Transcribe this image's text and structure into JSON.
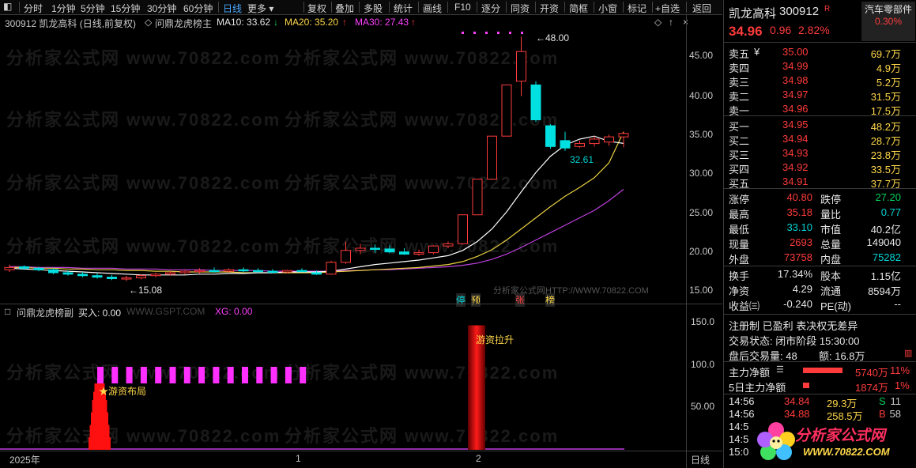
{
  "toolbar": {
    "left_items": [
      "分时",
      "1分钟",
      "5分钟",
      "15分钟",
      "30分钟",
      "60分钟",
      "日线",
      "更多"
    ],
    "right_items": [
      "复权",
      "叠加",
      "多股",
      "统计",
      "画线",
      "F10",
      "逐分",
      "同资",
      "开资",
      "简框",
      "小窗",
      "标记",
      "+自选",
      "返回"
    ],
    "active": "日线"
  },
  "infobar": {
    "code_name": "300912 凯龙高科 (日线,前复权)",
    "indicator": "问鼎龙虎榜主",
    "ma10": "MA10: 33.62",
    "ma10_arrow": "↓",
    "ma20": "MA20: 35.20",
    "ma20_arrow": "↑",
    "ma30": "MA30: 27.43",
    "ma30_arrow": "↑"
  },
  "main_chart": {
    "y_ticks": [
      "45.00",
      "40.00",
      "35.00",
      "30.00",
      "25.00",
      "20.00",
      "15.00"
    ],
    "high_label": "48.00",
    "low_label": "15.08",
    "mid_label": "32.61",
    "markers": [
      "停",
      "预",
      "张",
      "榜"
    ],
    "watermark_small": "分析家公式网HTTP://WWW.70822.COM",
    "watermark": "分析家公式网 www.70822.com"
  },
  "sub_chart": {
    "indicator": "问鼎龙虎榜副",
    "buy": "买入: 0.00",
    "site": "WWW.GSPT.COM",
    "xg": "XG: 0.00",
    "y_ticks": [
      "150.0",
      "100.0",
      "50.00"
    ],
    "label_layout": "★游资布局",
    "label_pull": "游资拉升"
  },
  "x_axis": {
    "year": "2025年",
    "m1": "1",
    "m2": "2",
    "period": "日线"
  },
  "quote": {
    "name": "凯龙高科",
    "code": "300912",
    "r_badge": "R",
    "sector": "汽车零部件",
    "price": "34.96",
    "change": "0.96",
    "pct": "2.82%",
    "sector_pct": "0.30%",
    "asks": [
      {
        "label": "卖五",
        "price": "35.00",
        "vol": "69.7万",
        "flag": "¥"
      },
      {
        "label": "卖四",
        "price": "34.99",
        "vol": "4.9万",
        "flag": ""
      },
      {
        "label": "卖三",
        "price": "34.98",
        "vol": "5.2万",
        "flag": ""
      },
      {
        "label": "卖二",
        "price": "34.97",
        "vol": "31.5万",
        "flag": ""
      },
      {
        "label": "卖一",
        "price": "34.96",
        "vol": "17.5万",
        "flag": ""
      }
    ],
    "bids": [
      {
        "label": "买一",
        "price": "34.95",
        "vol": "48.2万"
      },
      {
        "label": "买二",
        "price": "34.94",
        "vol": "28.7万"
      },
      {
        "label": "买三",
        "price": "34.93",
        "vol": "23.8万"
      },
      {
        "label": "买四",
        "price": "34.92",
        "vol": "33.5万"
      },
      {
        "label": "买五",
        "price": "34.91",
        "vol": "37.7万"
      }
    ],
    "stats": [
      {
        "l1": "涨停",
        "v1": "40.80",
        "c1": "red",
        "l2": "跌停",
        "v2": "27.20",
        "c2": "green"
      },
      {
        "l1": "最高",
        "v1": "35.18",
        "c1": "red",
        "l2": "量比",
        "v2": "0.77",
        "c2": "cyan"
      },
      {
        "l1": "最低",
        "v1": "33.10",
        "c1": "cyan",
        "l2": "市值",
        "v2": "40.2亿",
        "c2": "white"
      },
      {
        "l1": "现量",
        "v1": "2693",
        "c1": "red",
        "l2": "总量",
        "v2": "149040",
        "c2": "white"
      },
      {
        "l1": "外盘",
        "v1": "73758",
        "c1": "red",
        "l2": "内盘",
        "v2": "75282",
        "c2": "cyan"
      }
    ],
    "stats2": [
      {
        "l1": "换手",
        "v1": "17.34%",
        "l2": "股本",
        "v2": "1.15亿"
      },
      {
        "l1": "净资",
        "v1": "4.29",
        "l2": "流通",
        "v2": "8594万"
      },
      {
        "l1": "收益㈢",
        "v1": "-0.240",
        "l2": "PE(动)",
        "v2": "--"
      }
    ],
    "notes": {
      "line1": "注册制 已盈利 表决权无差异",
      "line2": "交易状态: 闭市阶段 15:30:00",
      "line3a": "盘后交易量: 48",
      "line3b": "额: 16.8万"
    },
    "flows": [
      {
        "label": "主力净额",
        "val": "5740万",
        "pct": "11%"
      },
      {
        "label": "5日主力净额",
        "val": "1874万",
        "pct": "1%"
      }
    ],
    "ticks": [
      {
        "t": "14:56",
        "p": "34.84",
        "v": "29.3万",
        "s": "S",
        "n": "11",
        "sc": "green"
      },
      {
        "t": "14:56",
        "p": "34.88",
        "v": "258.5万",
        "s": "B",
        "n": "58",
        "sc": "red"
      },
      {
        "t": "14:5",
        "p": "",
        "v": "",
        "s": "",
        "n": "",
        "sc": "gray"
      },
      {
        "t": "14:5",
        "p": "",
        "v": "",
        "s": "",
        "n": "",
        "sc": "gray"
      },
      {
        "t": "15:0",
        "p": "",
        "v": "",
        "s": "",
        "n": "",
        "sc": "gray"
      }
    ],
    "logo_text": "分析家公式网",
    "logo_url": "WWW.70822.COM"
  },
  "chart_data": {
    "type": "candlestick",
    "ylim": [
      13,
      49
    ],
    "candles": [
      [
        16.6,
        17.3,
        16.3,
        16.9
      ],
      [
        17.0,
        17.2,
        16.6,
        16.8
      ],
      [
        16.8,
        17.0,
        16.4,
        16.6
      ],
      [
        16.6,
        16.8,
        16.0,
        16.2
      ],
      [
        16.2,
        16.5,
        15.8,
        16.0
      ],
      [
        16.0,
        16.3,
        15.6,
        15.8
      ],
      [
        15.8,
        16.1,
        15.4,
        15.6
      ],
      [
        15.6,
        15.9,
        15.2,
        15.4
      ],
      [
        15.4,
        15.8,
        15.08,
        15.5
      ],
      [
        15.5,
        16.0,
        15.3,
        15.8
      ],
      [
        15.8,
        16.2,
        15.6,
        16.0
      ],
      [
        16.0,
        16.4,
        15.8,
        16.2
      ],
      [
        16.2,
        16.6,
        16.0,
        16.4
      ],
      [
        16.4,
        16.8,
        16.1,
        16.5
      ],
      [
        16.5,
        16.9,
        16.2,
        16.4
      ],
      [
        16.4,
        16.8,
        16.2,
        16.6
      ],
      [
        16.6,
        16.9,
        16.3,
        16.5
      ],
      [
        16.5,
        16.8,
        16.2,
        16.4
      ],
      [
        16.4,
        16.7,
        16.1,
        16.3
      ],
      [
        16.3,
        16.6,
        16.1,
        16.5
      ],
      [
        16.5,
        16.8,
        16.3,
        16.4
      ],
      [
        16.2,
        16.5,
        15.9,
        16.0
      ],
      [
        16.0,
        17.8,
        15.9,
        17.6
      ],
      [
        17.6,
        20.4,
        17.4,
        19.2
      ],
      [
        19.2,
        20.1,
        18.7,
        19.5
      ],
      [
        19.5,
        20.0,
        18.9,
        19.4
      ],
      [
        19.4,
        19.9,
        18.8,
        19.0
      ],
      [
        19.0,
        19.5,
        18.6,
        18.7
      ],
      [
        18.7,
        19.3,
        18.5,
        18.9
      ],
      [
        18.9,
        19.9,
        18.7,
        19.8
      ],
      [
        19.8,
        20.4,
        19.5,
        20.1
      ],
      [
        20.1,
        24.0,
        20.0,
        24.0
      ],
      [
        24.0,
        28.8,
        24.0,
        28.8
      ],
      [
        28.8,
        34.6,
        28.8,
        34.6
      ],
      [
        34.6,
        41.5,
        34.6,
        41.5
      ],
      [
        42.0,
        48.0,
        40.0,
        46.0
      ],
      [
        41.5,
        42.0,
        36.5,
        36.8
      ],
      [
        36.0,
        36.2,
        32.9,
        33.2
      ],
      [
        34.0,
        35.2,
        32.61,
        33.0
      ],
      [
        33.2,
        34.0,
        33.0,
        33.6
      ],
      [
        33.6,
        34.6,
        33.2,
        34.2
      ],
      [
        33.8,
        34.8,
        33.3,
        34.5
      ],
      [
        34.5,
        35.18,
        33.1,
        34.96
      ]
    ],
    "ma10": [
      16.8,
      16.7,
      16.6,
      16.5,
      16.4,
      16.3,
      16.2,
      16.1,
      16.0,
      15.9,
      15.9,
      15.9,
      15.9,
      16.0,
      16.0,
      16.1,
      16.1,
      16.2,
      16.2,
      16.3,
      16.3,
      16.3,
      16.4,
      16.7,
      17.0,
      17.3,
      17.5,
      17.7,
      17.9,
      18.2,
      18.5,
      19.2,
      20.4,
      22.1,
      24.4,
      27.1,
      29.7,
      31.9,
      33.4,
      34.2,
      34.6,
      33.9,
      33.62
    ],
    "ma20": [
      16.9,
      16.9,
      16.8,
      16.8,
      16.7,
      16.7,
      16.6,
      16.6,
      16.5,
      16.5,
      16.4,
      16.4,
      16.3,
      16.3,
      16.3,
      16.3,
      16.2,
      16.2,
      16.2,
      16.2,
      16.2,
      16.2,
      16.3,
      16.4,
      16.5,
      16.6,
      16.7,
      16.8,
      16.9,
      17.1,
      17.3,
      17.7,
      18.4,
      19.3,
      20.6,
      22.1,
      23.6,
      25.1,
      26.5,
      27.7,
      29.0,
      31.0,
      35.2
    ],
    "ma30": [
      17.0,
      17.0,
      16.9,
      16.9,
      16.9,
      16.8,
      16.8,
      16.8,
      16.7,
      16.7,
      16.7,
      16.6,
      16.6,
      16.6,
      16.5,
      16.5,
      16.5,
      16.5,
      16.4,
      16.4,
      16.4,
      16.4,
      16.4,
      16.5,
      16.5,
      16.6,
      16.6,
      16.7,
      16.8,
      16.9,
      17.0,
      17.2,
      17.5,
      18.0,
      18.7,
      19.6,
      20.6,
      21.6,
      22.6,
      23.6,
      24.6,
      25.9,
      27.43
    ],
    "sub_ylim": [
      0,
      160
    ],
    "magenta_bars": [
      100,
      100,
      100,
      100,
      100,
      100,
      100,
      100,
      100,
      100,
      100,
      100,
      100,
      100,
      100
    ],
    "red_stack": [
      15,
      30,
      45,
      60,
      70,
      80
    ],
    "pull_bar": 150
  }
}
